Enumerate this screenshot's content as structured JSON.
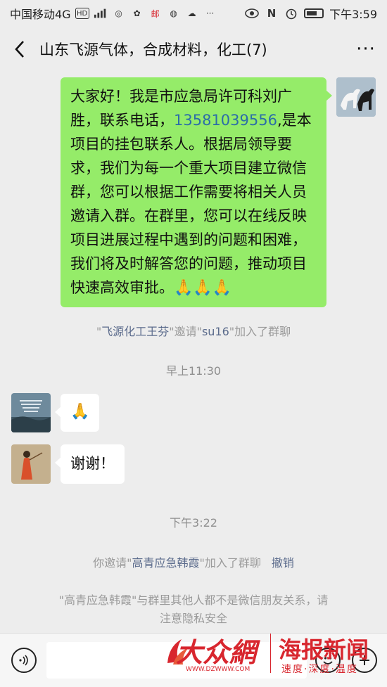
{
  "status_bar": {
    "carrier": "中国移动4G",
    "hd": "HD",
    "signal": "4G",
    "time": "下午3:59"
  },
  "header": {
    "title": "山东飞源气体，合成材料，化工(7)",
    "back_icon": "chevron-left-icon",
    "more_icon": "more-dots-icon",
    "more_label": "···"
  },
  "messages": {
    "m1": {
      "text_before": "大家好！我是市应急局许可科刘广胜，联系电话，",
      "phone": "13581039556",
      "text_after": ",是本项目的挂包联系人。根据局领导要求，我们为每一个重大项目建立微信群，您可以根据工作需要将相关人员邀请入群。在群里，您可以在线反映项目进展过程中遇到的问题和困难，我们将及时解答您的问题，推动项目快速高效审批。",
      "emoji": "🙏🙏🙏"
    },
    "sys1": {
      "q1": "\"",
      "name1": "飞源化工王芬",
      "mid": "\"邀请\"",
      "name2": "su16",
      "end": "\"加入了群聊"
    },
    "time1": "早上11:30",
    "m2": {
      "emoji": "🙏"
    },
    "m3": {
      "text": "谢谢！"
    },
    "time2": "下午3:22",
    "sys2": {
      "prefix": "你邀请\"",
      "name": "高青应急韩霞",
      "suffix": "\"加入了群聊",
      "revoke": "撤销"
    },
    "sys3": {
      "line1": "\"高青应急韩霞\"与群里其他人都不是微信朋友关系，请",
      "line2": "注意隐私安全"
    }
  },
  "input_bar": {
    "voice_icon": "voice-icon",
    "emoji_icon": "emoji-icon",
    "plus_icon": "plus-icon"
  },
  "watermark": {
    "logo": "大众網",
    "url": "WWW.DZWWW.COM",
    "brand": "海报新闻",
    "slogan": "速度·深度·温度"
  }
}
